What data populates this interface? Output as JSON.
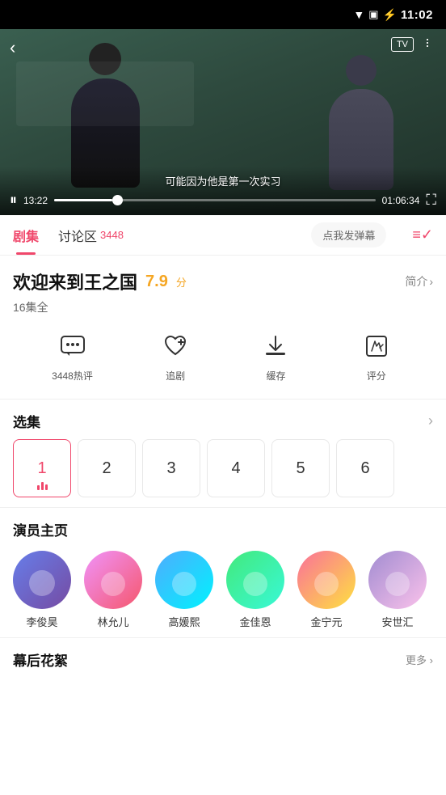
{
  "statusBar": {
    "time": "11:02",
    "batteryIcon": "🔋"
  },
  "videoPlayer": {
    "backLabel": "‹",
    "tvLabel": "TV",
    "subtitle": "可能因为他是第一次实习",
    "timeStart": "13:22",
    "timeEnd": "01:06:34",
    "progressPercent": 18
  },
  "tabs": {
    "episodes": "剧集",
    "discussion": "讨论区",
    "discussionCount": "3448",
    "danmuPlaceholder": "点我发弹幕"
  },
  "showInfo": {
    "title": "欢迎来到王之国",
    "rating": "7.9",
    "ratingUnit": "分",
    "introLabel": "简介",
    "episodeCount": "16集全"
  },
  "actions": [
    {
      "id": "comment",
      "icon": "💬",
      "label": "3448热评"
    },
    {
      "id": "follow",
      "icon": "🤍",
      "label": "追剧"
    },
    {
      "id": "download",
      "icon": "⬇",
      "label": "缓存"
    },
    {
      "id": "rate",
      "icon": "✏️",
      "label": "评分"
    }
  ],
  "selectEpisode": {
    "title": "选集",
    "episodes": [
      {
        "num": "1",
        "active": true
      },
      {
        "num": "2",
        "active": false
      },
      {
        "num": "3",
        "active": false
      },
      {
        "num": "4",
        "active": false
      },
      {
        "num": "5",
        "active": false
      },
      {
        "num": "6",
        "active": false
      }
    ]
  },
  "cast": {
    "title": "演员主页",
    "members": [
      {
        "id": 1,
        "name": "李俊昊",
        "avatarClass": "av1",
        "emoji": "👨"
      },
      {
        "id": 2,
        "name": "林允儿",
        "avatarClass": "av2",
        "emoji": "👩"
      },
      {
        "id": 3,
        "name": "高媛熙",
        "avatarClass": "av3",
        "emoji": "👩"
      },
      {
        "id": 4,
        "name": "金佳恩",
        "avatarClass": "av4",
        "emoji": "👩"
      },
      {
        "id": 5,
        "name": "金宁元",
        "avatarClass": "av5",
        "emoji": "👨"
      },
      {
        "id": 6,
        "name": "安世汇",
        "avatarClass": "av6",
        "emoji": "👨"
      }
    ]
  },
  "bts": {
    "title": "幕后花絮",
    "moreLabel": "更多 ›"
  }
}
